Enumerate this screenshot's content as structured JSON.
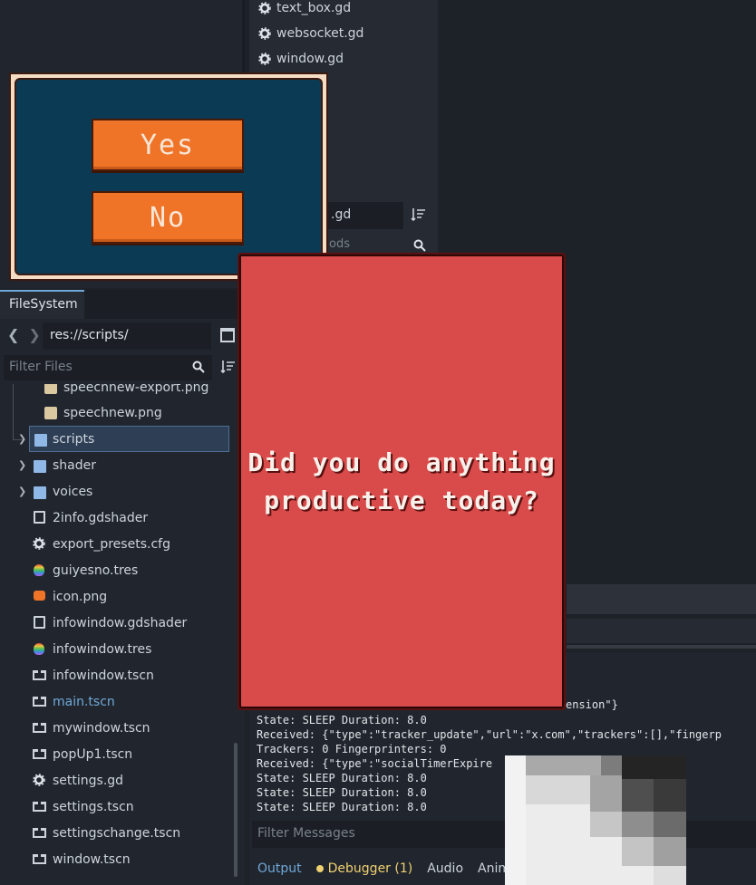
{
  "script_list": {
    "items": [
      "text_box.gd",
      "websocket.gd",
      "window.gd"
    ],
    "filter_value": ".gd",
    "methods_placeholder": "ods"
  },
  "popup": {
    "yes_label": "Yes",
    "no_label": "No"
  },
  "filesystem": {
    "tab_label": "FileSystem",
    "path": "res://scripts/",
    "filter_placeholder": "Filter Files",
    "items": [
      {
        "label": "speechnew-export.png",
        "icon": "png-icon"
      },
      {
        "label": "speechnew.png",
        "icon": "png-icon"
      },
      {
        "label": "scripts",
        "icon": "folder-icon"
      },
      {
        "label": "shader",
        "icon": "folder-icon"
      },
      {
        "label": "voices",
        "icon": "folder-icon"
      },
      {
        "label": "2info.gdshader",
        "icon": "shader-icon"
      },
      {
        "label": "export_presets.cfg",
        "icon": "gear-icon"
      },
      {
        "label": "guiyesno.tres",
        "icon": "resource-icon"
      },
      {
        "label": "icon.png",
        "icon": "godot-icon"
      },
      {
        "label": "infowindow.gdshader",
        "icon": "shader-icon"
      },
      {
        "label": "infowindow.tres",
        "icon": "resource-icon"
      },
      {
        "label": "infowindow.tscn",
        "icon": "scene-icon"
      },
      {
        "label": "main.tscn",
        "icon": "scene-icon"
      },
      {
        "label": "mywindow.tscn",
        "icon": "scene-icon"
      },
      {
        "label": "popUp1.tscn",
        "icon": "scene-icon"
      },
      {
        "label": "settings.gd",
        "icon": "gear-icon"
      },
      {
        "label": "settings.tscn",
        "icon": "scene-icon"
      },
      {
        "label": "settingschange.tscn",
        "icon": "scene-icon"
      },
      {
        "label": "window.tscn",
        "icon": "scene-icon"
      }
    ]
  },
  "dialog": {
    "line1": "Did you do anything",
    "line2": "productive today?"
  },
  "output": {
    "lines": [
      "ension\"}",
      "State: SLEEP Duration: 8.0",
      "Received: {\"type\":\"tracker_update\",\"url\":\"x.com\",\"trackers\":[],\"fingerp",
      "Trackers: 0 Fingerprinters: 0",
      "Received: {\"type\":\"socialTimerExpire",
      "State: SLEEP Duration: 8.0",
      "State: SLEEP Duration: 8.0",
      "State: SLEEP Duration: 8.0"
    ],
    "filter_placeholder": "Filter Messages",
    "tabs": {
      "output": "Output",
      "debugger": "Debugger (1)",
      "audio": "Audio",
      "animation": "Anima"
    }
  },
  "colors": {
    "accent": "#6fa8d8",
    "popup_bg": "#0b3b54",
    "button_orange": "#f07428",
    "dialog_red": "#d94b4b"
  }
}
